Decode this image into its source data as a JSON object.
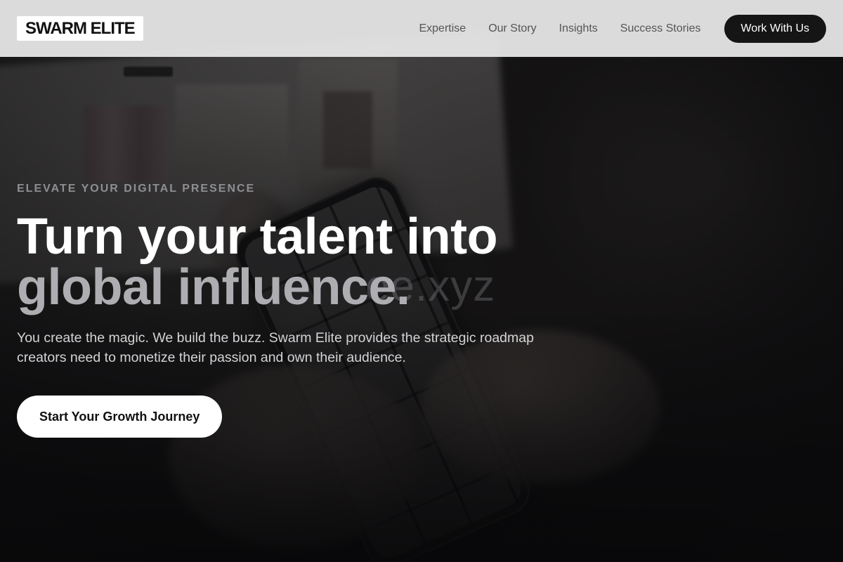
{
  "brand": {
    "logo_text": "SWARM ELITE"
  },
  "nav": {
    "links": [
      "Expertise",
      "Our Story",
      "Insights",
      "Success Stories"
    ],
    "cta_label": "Work With Us"
  },
  "hero": {
    "eyebrow": "ELEVATE YOUR DIGITAL PRESENCE",
    "headline_line1": "Turn your talent into",
    "headline_line2": "global influence.",
    "subtext": "You create the magic. We build the buzz. Swarm Elite provides the strategic roadmap creators need to monetize their passion and own their audience.",
    "cta_label": "Start Your Growth Journey",
    "background_watermark": "ee.xyz"
  },
  "colors": {
    "header_bg": "#e8e8e8",
    "dark_button": "#151515",
    "headline_primary": "#ffffff",
    "headline_secondary": "#aeaeb2",
    "eyebrow": "#8e8e92"
  }
}
